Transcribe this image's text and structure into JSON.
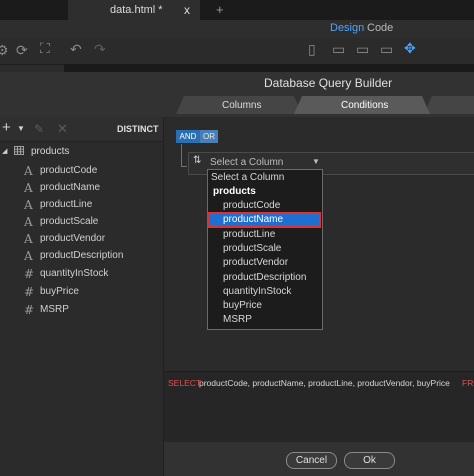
{
  "app": {
    "doc_tab": "data.html *",
    "close_glyph": "x",
    "new_tab_glyph": "+",
    "view_modes": {
      "design": "Design",
      "code": "Code"
    },
    "active_view": "Design"
  },
  "dialog": {
    "title": "Database Query Builder",
    "tabs": [
      {
        "label": "Columns",
        "active": false
      },
      {
        "label": "Conditions",
        "active": true
      }
    ],
    "distinct_label": "DISTINCT",
    "tree": {
      "root": "products",
      "columns": [
        {
          "name": "productCode",
          "type_icon": "A"
        },
        {
          "name": "productName",
          "type_icon": "A"
        },
        {
          "name": "productLine",
          "type_icon": "A"
        },
        {
          "name": "productScale",
          "type_icon": "A"
        },
        {
          "name": "productVendor",
          "type_icon": "A"
        },
        {
          "name": "productDescription",
          "type_icon": "A"
        },
        {
          "name": "quantityInStock",
          "type_icon": "#"
        },
        {
          "name": "buyPrice",
          "type_icon": "#"
        },
        {
          "name": "MSRP",
          "type_icon": "#"
        }
      ]
    },
    "conditions": {
      "and_label": "AND",
      "or_label": "OR",
      "select_placeholder": "Select a Column"
    },
    "dropdown": {
      "placeholder": "Select a Column",
      "group": "products",
      "options": [
        "productCode",
        "productName",
        "productLine",
        "productScale",
        "productVendor",
        "productDescription",
        "quantityInStock",
        "buyPrice",
        "MSRP"
      ],
      "highlighted": "productName"
    },
    "sql": {
      "keyword": "SELECT",
      "text": "productCode, productName, productLine, productVendor, buyPrice",
      "trailing": "FRO"
    },
    "buttons": {
      "cancel": "Cancel",
      "ok": "Ok"
    }
  },
  "colors": {
    "accent": "#1e6fd0",
    "highlight_border": "#e03030",
    "sql_keyword": "#e05050"
  }
}
